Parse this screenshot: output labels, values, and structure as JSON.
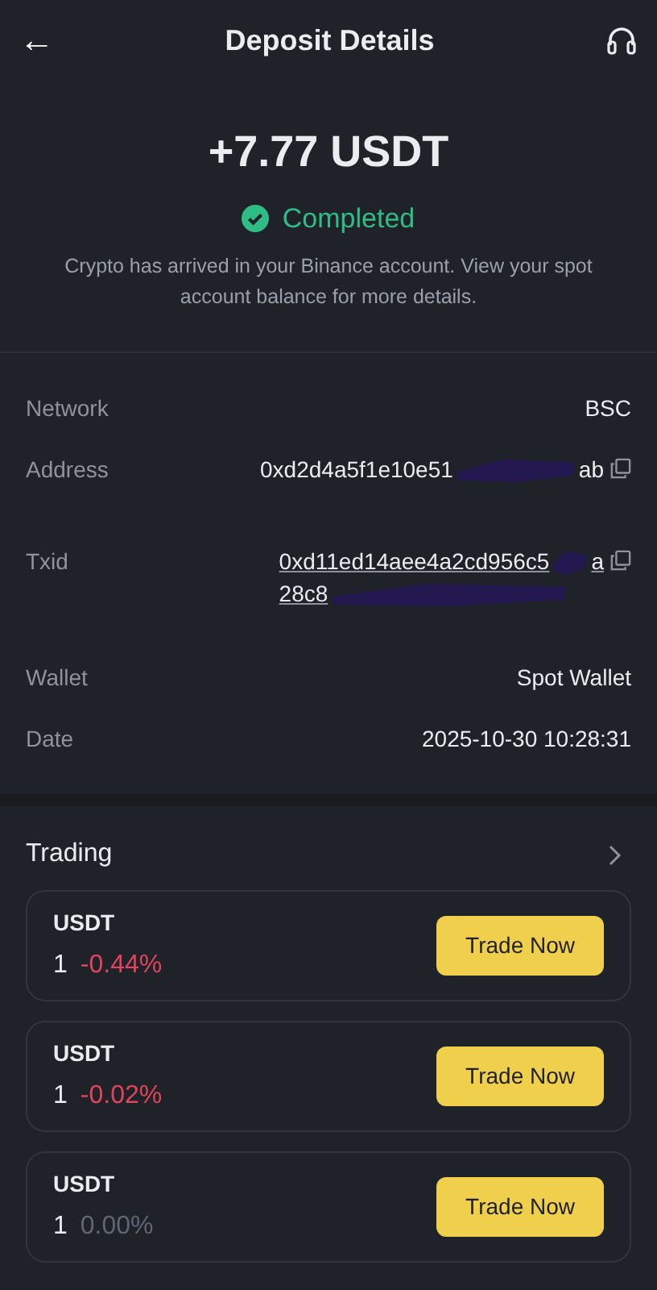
{
  "header": {
    "back": "←",
    "title": "Deposit Details"
  },
  "summary": {
    "amount": "+7.77 USDT",
    "status": "Completed",
    "message": "Crypto has arrived in your Binance account. View your spot account balance for more details."
  },
  "details": [
    {
      "kind": "plain",
      "label": "Network",
      "value": "BSC"
    },
    {
      "kind": "copy",
      "label": "Address",
      "lines": [
        {
          "start": "0xd2d4a5f1e10e51",
          "end": "ab"
        }
      ]
    },
    {
      "kind": "copy_link",
      "label": "Txid",
      "lines": [
        {
          "start": "0xd11ed14aee4a2cd956c5",
          "end": "a"
        },
        {
          "start": "28c8"
        }
      ]
    },
    {
      "kind": "plain",
      "label": "Wallet",
      "value": "Spot Wallet"
    },
    {
      "kind": "plain",
      "label": "Date",
      "value": "2025-10-30 10:28:31"
    }
  ],
  "trading": {
    "title": "Trading",
    "items": [
      {
        "symbol": "USDT",
        "price": "1",
        "change": "-0.44%",
        "color": "#e0455b",
        "button": "Trade Now"
      },
      {
        "symbol": "USDT",
        "price": "1",
        "change": "-0.02%",
        "color": "#e0455b",
        "button": "Trade Now"
      },
      {
        "symbol": "USDT",
        "price": "1",
        "change": "0.00%",
        "color": "#5e6673",
        "button": "Trade Now"
      }
    ]
  }
}
